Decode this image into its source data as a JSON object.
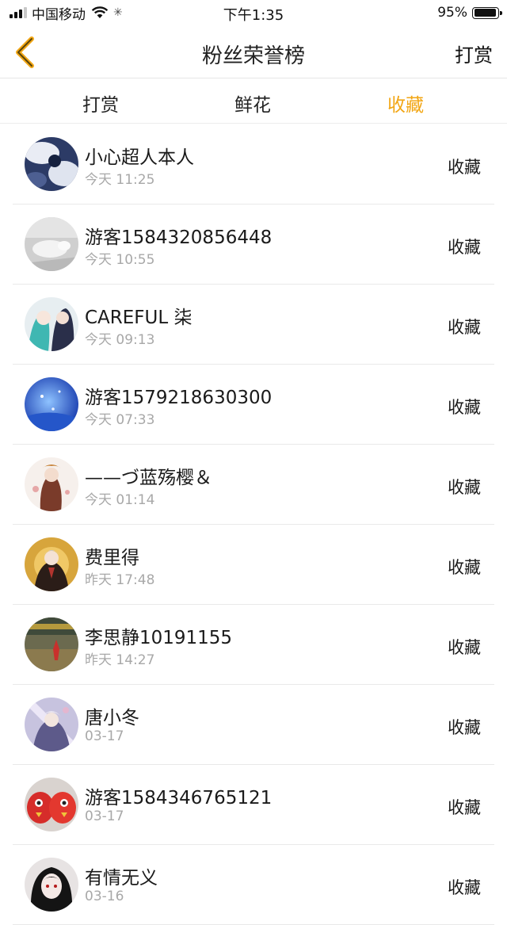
{
  "status_bar": {
    "carrier": "中国移动",
    "time": "下午1:35",
    "battery": "95%",
    "battery_level": 0.95
  },
  "nav": {
    "title": "粉丝荣誉榜",
    "right_label": "打赏",
    "accent_color": "#f2a614"
  },
  "tabs": [
    {
      "label": "打赏",
      "active": false
    },
    {
      "label": "鲜花",
      "active": false
    },
    {
      "label": "收藏",
      "active": true
    }
  ],
  "fans": [
    {
      "name": "小心超人本人",
      "time": "今天 11:25",
      "action": "收藏"
    },
    {
      "name": "游客1584320856448",
      "time": "今天 10:55",
      "action": "收藏"
    },
    {
      "name": "CAREFUL 柒",
      "time": "今天 09:13",
      "action": "收藏"
    },
    {
      "name": "游客1579218630300",
      "time": "今天 07:33",
      "action": "收藏"
    },
    {
      "name": "——づ蓝殇樱＆",
      "time": "今天 01:14",
      "action": "收藏"
    },
    {
      "name": "费里得",
      "time": "昨天 17:48",
      "action": "收藏"
    },
    {
      "name": "李思静10191155",
      "time": "昨天 14:27",
      "action": "收藏"
    },
    {
      "name": "唐小冬",
      "time": "03-17",
      "action": "收藏"
    },
    {
      "name": "游客1584346765121",
      "time": "03-17",
      "action": "收藏"
    },
    {
      "name": "有情无义",
      "time": "03-16",
      "action": "收藏"
    }
  ]
}
